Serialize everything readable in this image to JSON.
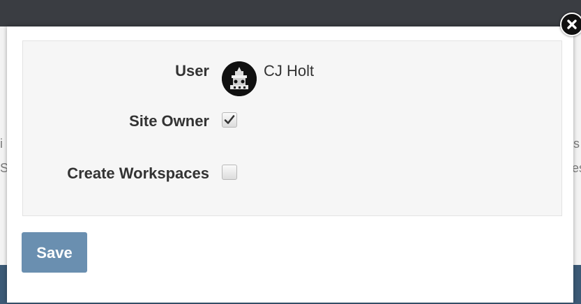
{
  "dialog": {
    "rows": {
      "user": {
        "label": "User",
        "value": "CJ Holt"
      },
      "site_owner": {
        "label": "Site Owner",
        "checked": true
      },
      "create_workspaces": {
        "label": "Create Workspaces",
        "checked": false
      }
    },
    "save_label": "Save",
    "close_icon": "close-icon"
  },
  "background": {
    "left_fragments": [
      "i",
      "S"
    ],
    "right_fragments": [
      "s",
      "es"
    ]
  },
  "colors": {
    "save_button": "#6a8fb0",
    "header": "#3a3d42",
    "footer": "#3c5a76"
  }
}
